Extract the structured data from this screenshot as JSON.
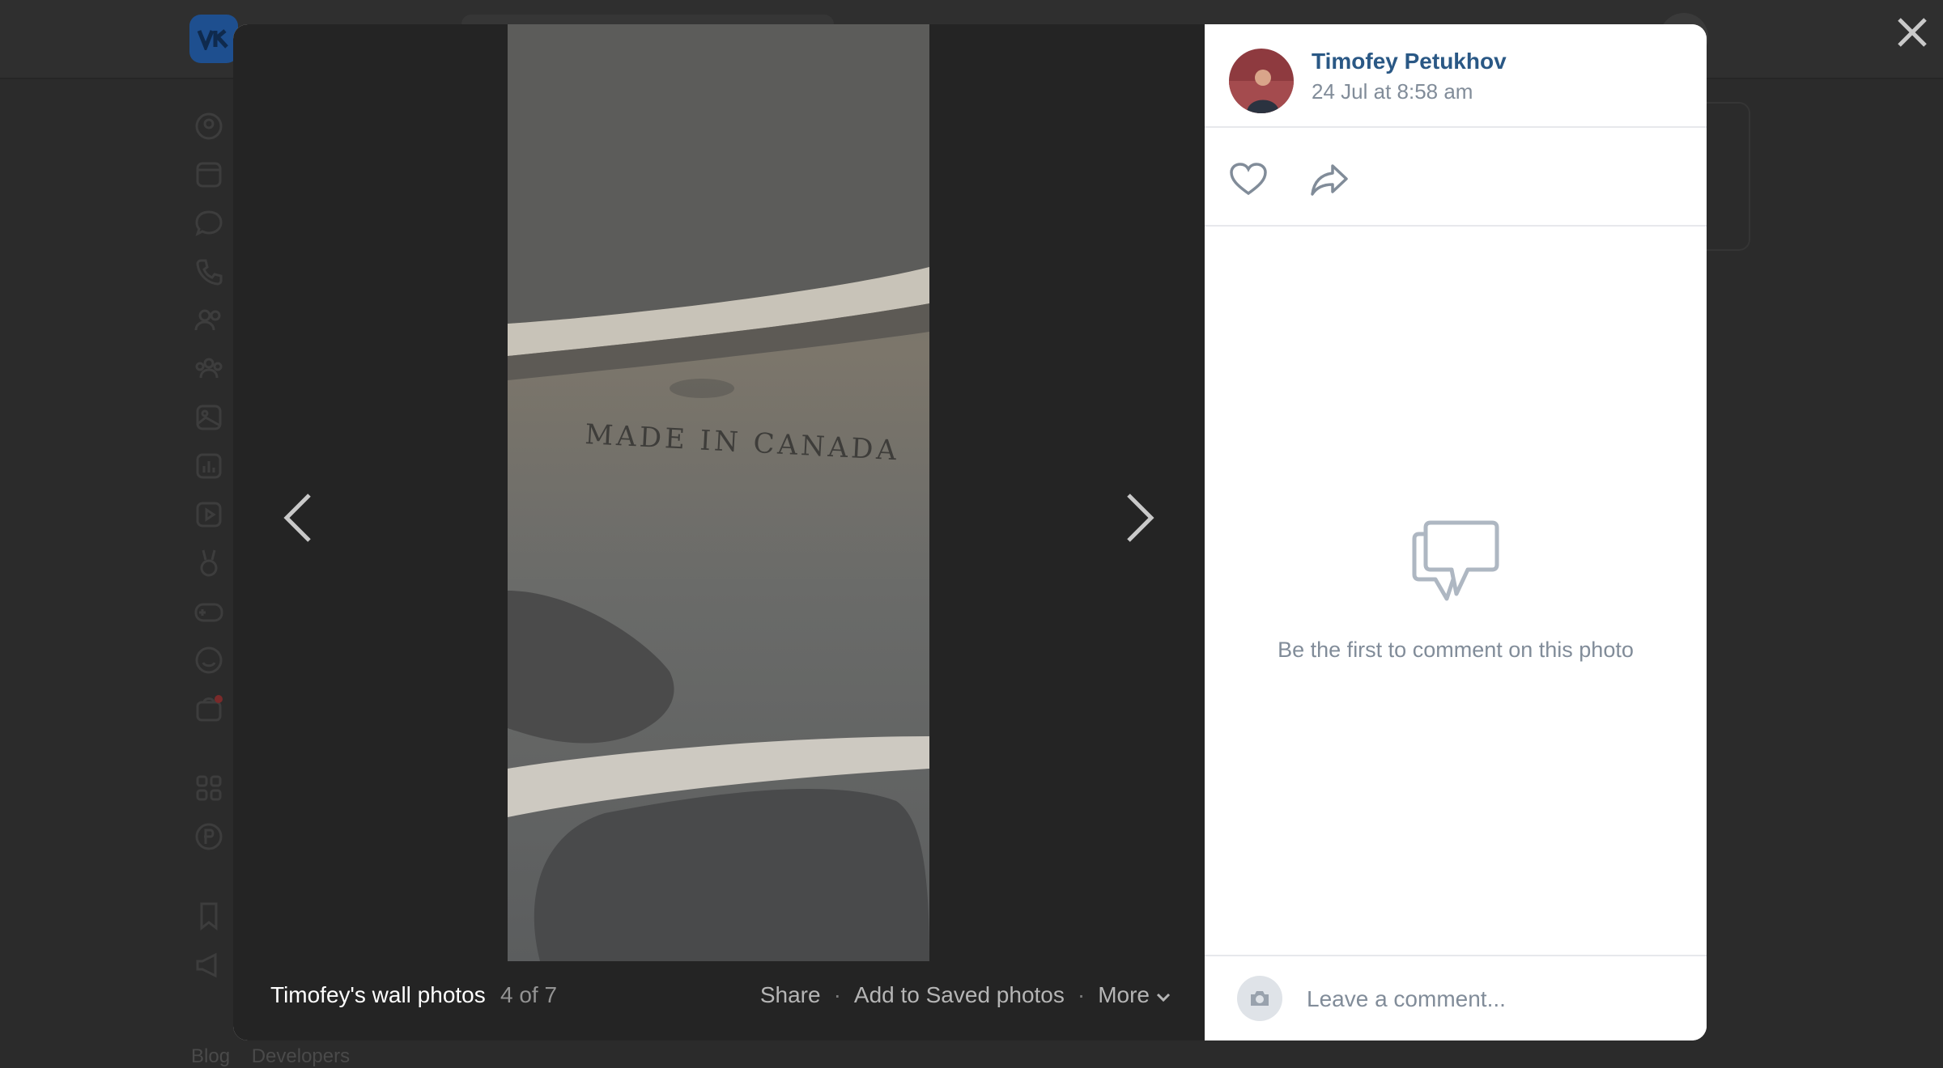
{
  "background": {
    "footer_links": [
      "Blog",
      "Developers"
    ]
  },
  "viewer": {
    "album_title": "Timofey's wall photos",
    "counter": "4 of 7",
    "actions": {
      "share": "Share",
      "save": "Add to Saved photos",
      "more": "More"
    },
    "photo_text": "MADE IN CANADA"
  },
  "panel": {
    "author_name": "Timofey Petukhov",
    "date": "24 Jul at 8:58 am",
    "empty_comments": "Be the first to comment on this photo",
    "comment_placeholder": "Leave a comment..."
  },
  "colors": {
    "accent": "#2a5885",
    "muted": "#818c99",
    "notification": "#e64646"
  }
}
